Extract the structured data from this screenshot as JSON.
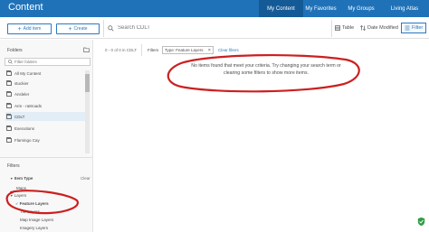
{
  "header": {
    "app_title": "Content",
    "tabs": [
      {
        "label": "My Content",
        "active": true
      },
      {
        "label": "My Favorites",
        "active": false
      },
      {
        "label": "My Groups",
        "active": false
      },
      {
        "label": "Living Atlas",
        "active": false
      }
    ]
  },
  "toolbar": {
    "add_item_label": "Add item",
    "create_label": "Create",
    "search_placeholder": "Search CDLT",
    "table_label": "Table",
    "sort_label": "Date Modified",
    "filter_label": "Filter"
  },
  "sidebar": {
    "folders_heading": "Folders",
    "filter_folders_placeholder": "Filter folders",
    "folders": [
      {
        "label": "All My Content",
        "selected": false
      },
      {
        "label": "stuckier",
        "selected": false
      },
      {
        "label": "Ansleler",
        "selected": false
      },
      {
        "label": "Arm - ra8roads",
        "selected": false
      },
      {
        "label": "CDLT",
        "selected": true
      },
      {
        "label": "Executions",
        "selected": false
      },
      {
        "label": "Flamingo Cay",
        "selected": false
      }
    ],
    "filters_heading": "Filters",
    "item_type_heading": "Item Type",
    "clear_label": "Clear",
    "item_types": {
      "maps": "Maps",
      "layers": "Layers",
      "feature_layers": "Feature Layers",
      "tile_layers": "Tile Layers",
      "map_image_layers": "Map Image Layers",
      "imagery_layers": "Imagery Layers"
    }
  },
  "main": {
    "count_text": "0 - 0 of 0 in CDLT",
    "filters_label": "Filters",
    "chip_label": "Type: Feature Layers",
    "chip_close": "×",
    "clear_filters_label": "Clear filters",
    "empty_line1": "No items found that meet your criteria. Try changing your search term or",
    "empty_line2": "clearing some filters to show more items."
  },
  "colors": {
    "header": "#1f72b8",
    "accent": "#2a7ac0",
    "annotation": "#cc1f1f"
  }
}
